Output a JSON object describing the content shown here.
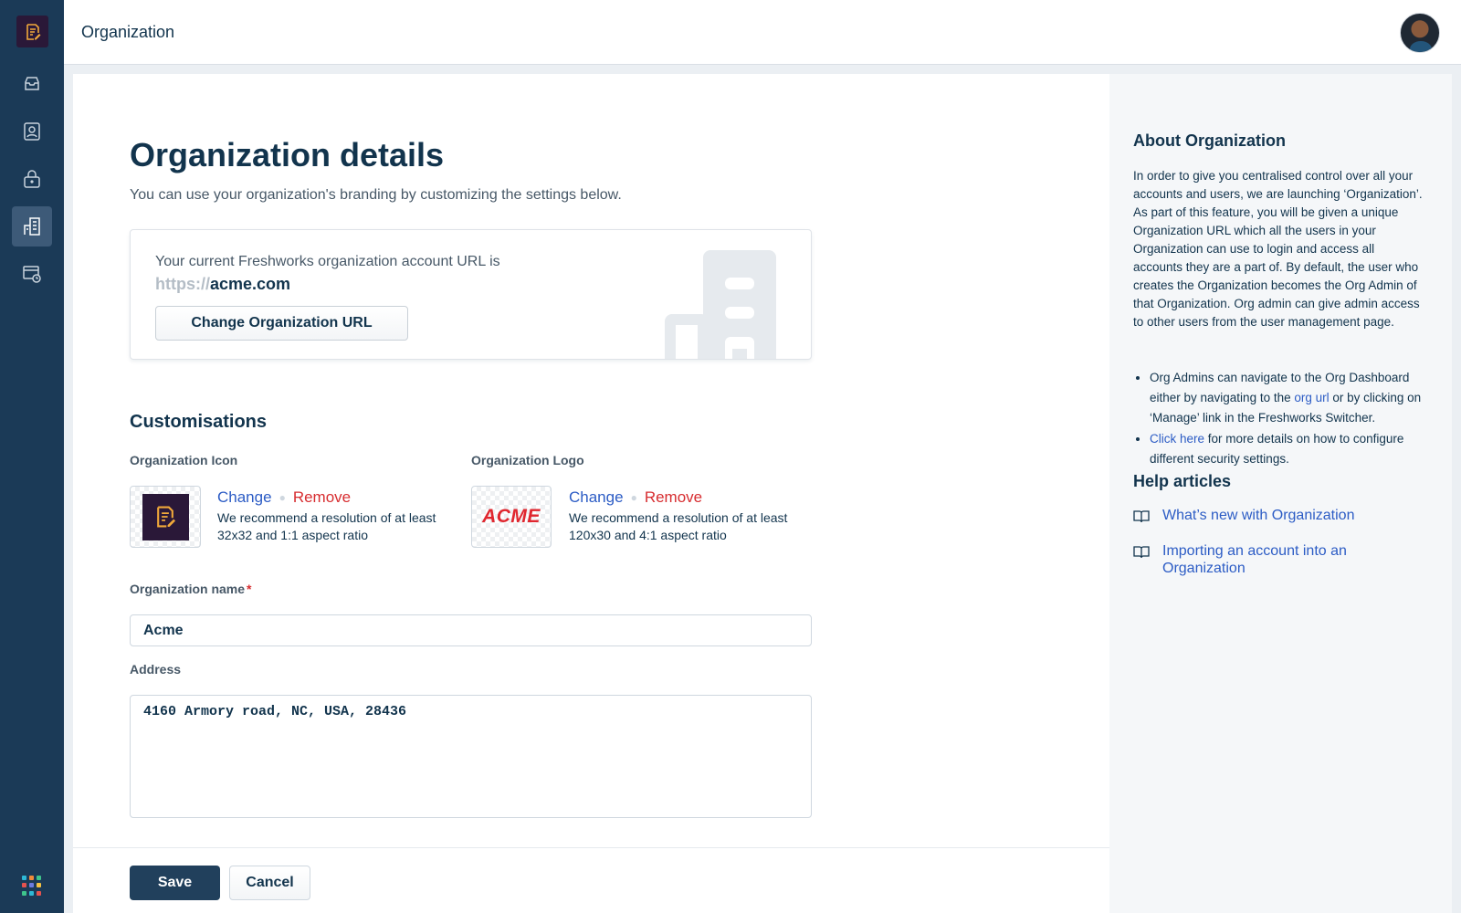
{
  "header": {
    "title": "Organization"
  },
  "sidebar": {
    "items": [
      {
        "icon": "inbox-icon"
      },
      {
        "icon": "user-icon"
      },
      {
        "icon": "lock-icon"
      },
      {
        "icon": "organization-icon",
        "active": true
      },
      {
        "icon": "schedule-icon"
      }
    ]
  },
  "page": {
    "title": "Organization details",
    "subtitle": "You can use your organization's branding by customizing the settings below.",
    "url_card": {
      "label": "Your current Freshworks organization account URL is",
      "protocol": "https://",
      "domain": "acme.com",
      "button": "Change Organization URL"
    },
    "customisations": {
      "title": "Customisations",
      "icon": {
        "label": "Organization Icon",
        "change": "Change",
        "remove": "Remove",
        "hint": "We recommend a resolution of at least 32x32 and 1:1 aspect ratio"
      },
      "logo": {
        "label": "Organization Logo",
        "logo_text": "ACME",
        "change": "Change",
        "remove": "Remove",
        "hint": "We recommend a resolution of at least 120x30 and 4:1 aspect ratio"
      }
    },
    "name_field": {
      "label": "Organization name",
      "required_mark": "*",
      "value": "Acme"
    },
    "address_field": {
      "label": "Address",
      "value": "4160 Armory road, NC, USA, 28436"
    },
    "actions": {
      "save": "Save",
      "cancel": "Cancel"
    }
  },
  "aside": {
    "title": "About Organization",
    "body": "In order to give you centralised control over all your accounts and users, we are launching ‘Organization’. As part of this feature, you will be given a unique Organization URL which all the users in your Organization can use to login and access all accounts they are a part of. By default, the user who creates the Organization becomes the Org Admin of that Organization. Org admin can give admin access to other users from the user management page.",
    "bullets": [
      {
        "before": "Org Admins can navigate to the Org Dashboard either by navigating to the ",
        "link": "org url",
        "after": " or by clicking on ‘Manage’ link in the Freshworks Switcher."
      },
      {
        "before": "",
        "link": "Click here",
        "after": " for more details on how to configure different security settings."
      }
    ],
    "help_title": "Help articles",
    "help_articles": [
      "What’s new with Organization",
      "Importing an account into an Organization"
    ]
  },
  "colors": {
    "sidebar_bg": "#1b3a57",
    "primary_button": "#21405c",
    "link": "#2c5cc5",
    "danger": "#d72d30",
    "brand_logo": "#e0272f"
  }
}
